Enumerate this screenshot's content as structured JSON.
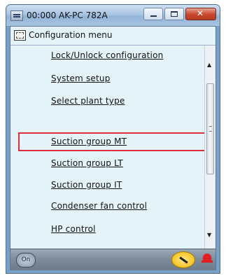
{
  "window": {
    "title": "00:000 AK-PC 782A"
  },
  "header": {
    "title": "Configuration menu"
  },
  "menu": {
    "items": [
      {
        "label": "Lock/Unlock configuration"
      },
      {
        "label": "System setup"
      },
      {
        "label": "Select plant type"
      },
      {
        "label": "Suction group MT",
        "highlighted": true
      },
      {
        "label": "Suction group LT"
      },
      {
        "label": "Suction group IT"
      },
      {
        "label": "Condenser fan control"
      },
      {
        "label": "HP control"
      }
    ]
  },
  "statusbar": {
    "left_label": "On",
    "icons": [
      "power-icon",
      "wrench-icon",
      "alarm-bell-icon"
    ]
  },
  "colors": {
    "highlight_border": "#d9303a",
    "client_background": "#e4f3f7",
    "alarm": "#e02020"
  }
}
